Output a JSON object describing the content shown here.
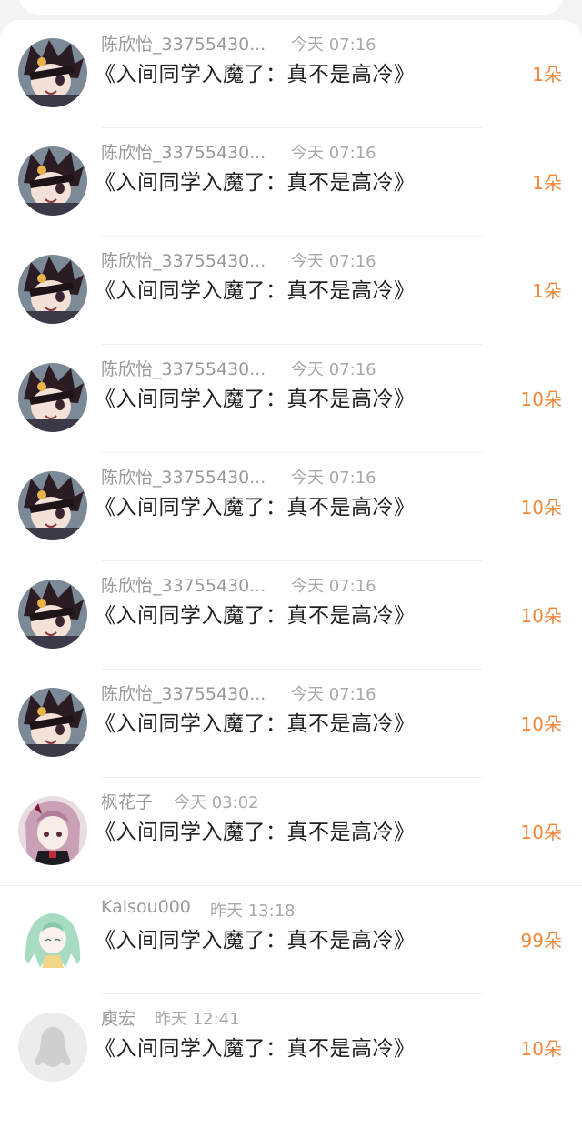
{
  "accent_color": "#f0873a",
  "items": [
    {
      "name": "陈欣怡_33755430...",
      "time": "今天 07:16",
      "title": "《入间同学入魔了：真不是高冷》",
      "count": "1朵",
      "avatar": "anime-dark-hair-avatar"
    },
    {
      "name": "陈欣怡_33755430...",
      "time": "今天 07:16",
      "title": "《入间同学入魔了：真不是高冷》",
      "count": "1朵",
      "avatar": "anime-dark-hair-avatar"
    },
    {
      "name": "陈欣怡_33755430...",
      "time": "今天 07:16",
      "title": "《入间同学入魔了：真不是高冷》",
      "count": "1朵",
      "avatar": "anime-dark-hair-avatar"
    },
    {
      "name": "陈欣怡_33755430...",
      "time": "今天 07:16",
      "title": "《入间同学入魔了：真不是高冷》",
      "count": "10朵",
      "avatar": "anime-dark-hair-avatar"
    },
    {
      "name": "陈欣怡_33755430...",
      "time": "今天 07:16",
      "title": "《入间同学入魔了：真不是高冷》",
      "count": "10朵",
      "avatar": "anime-dark-hair-avatar"
    },
    {
      "name": "陈欣怡_33755430...",
      "time": "今天 07:16",
      "title": "《入间同学入魔了：真不是高冷》",
      "count": "10朵",
      "avatar": "anime-dark-hair-avatar"
    },
    {
      "name": "陈欣怡_33755430...",
      "time": "今天 07:16",
      "title": "《入间同学入魔了：真不是高冷》",
      "count": "10朵",
      "avatar": "anime-dark-hair-avatar"
    },
    {
      "name": "枫花子",
      "time": "今天 03:02",
      "title": "《入间同学入魔了：真不是高冷》",
      "count": "10朵",
      "avatar": "anime-pink-hair-avatar"
    },
    {
      "name": "Kaisou000",
      "time": "昨天 13:18",
      "title": "《入间同学入魔了：真不是高冷》",
      "count": "99朵",
      "avatar": "anime-green-hair-avatar"
    },
    {
      "name": "庾宏",
      "time": "昨天 12:41",
      "title": "《入间同学入魔了：真不是高冷》",
      "count": "10朵",
      "avatar": "default-penguin-avatar"
    }
  ]
}
